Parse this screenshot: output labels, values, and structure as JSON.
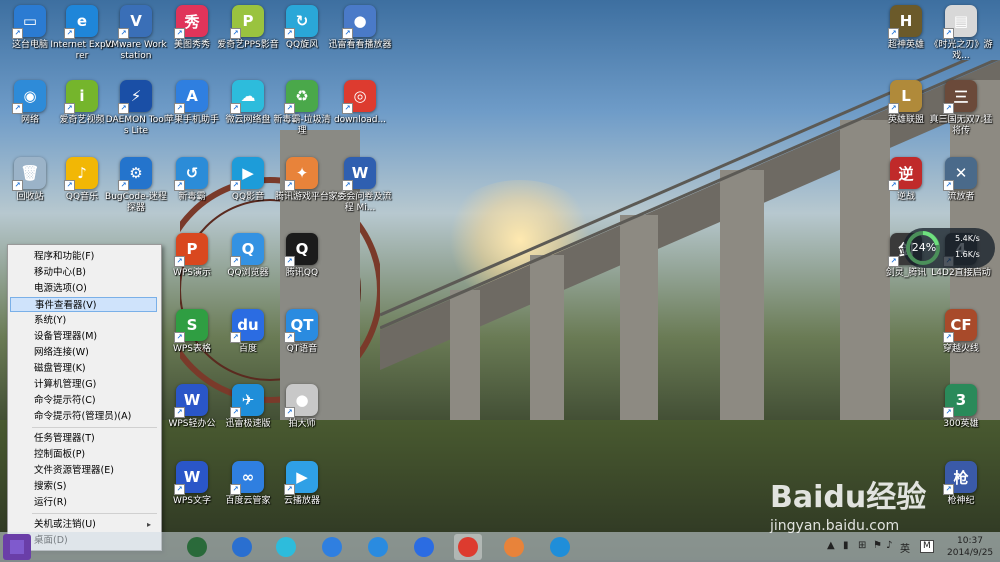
{
  "desktop_icons": [
    {
      "label": "这台电脑",
      "color": "#2b7bd2",
      "glyph": "▭"
    },
    {
      "label": "Internet Explorer",
      "color": "#1f86d9",
      "glyph": "e"
    },
    {
      "label": "VMware Workstation",
      "color": "#3a6fb7",
      "glyph": "V"
    },
    {
      "label": "美图秀秀",
      "color": "#e0345a",
      "glyph": "秀"
    },
    {
      "label": "爱奇艺PPS影音",
      "color": "#9ac33f",
      "glyph": "P"
    },
    {
      "label": "QQ旋风",
      "color": "#2aa7d8",
      "glyph": "↻"
    },
    {
      "label": "迅雷看看播放器",
      "color": "#4a7ac8",
      "glyph": "●"
    },
    {
      "label": "网络",
      "color": "#2e8bd8",
      "glyph": "◉"
    },
    {
      "label": "爱奇艺视频",
      "color": "#75b52c",
      "glyph": "i"
    },
    {
      "label": "DAEMON Tools Lite",
      "color": "#1a4fa6",
      "glyph": "⚡"
    },
    {
      "label": "苹果手机助手",
      "color": "#2f7fe0",
      "glyph": "A"
    },
    {
      "label": "微云网络盘",
      "color": "#2dbcdc",
      "glyph": "☁"
    },
    {
      "label": "新毒霸-垃圾清理",
      "color": "#4aa84a",
      "glyph": "♻"
    },
    {
      "label": "download...",
      "color": "#dd3b2f",
      "glyph": "◎"
    },
    {
      "label": "回收站",
      "color": "#9bb3c8",
      "glyph": "🗑"
    },
    {
      "label": "QQ音乐",
      "color": "#f2b705",
      "glyph": "♪"
    },
    {
      "label": "BugCode-迷程探器",
      "color": "#2474cc",
      "glyph": "⚙"
    },
    {
      "label": "新毒霸",
      "color": "#2b8cd8",
      "glyph": "↺"
    },
    {
      "label": "QQ影音",
      "color": "#1d9cd9",
      "glyph": "▶"
    },
    {
      "label": "腾讯游戏平台",
      "color": "#e8833a",
      "glyph": "✦"
    },
    {
      "label": "家委会问卷及流程 Mi...",
      "color": "#2f5fb0",
      "glyph": "W"
    },
    {
      "label": "WPS演示",
      "color": "#d9481f",
      "glyph": "P"
    },
    {
      "label": "QQ浏览器",
      "color": "#3492e2",
      "glyph": "Q"
    },
    {
      "label": "腾讯QQ",
      "color": "#1b1b1b",
      "glyph": "Q"
    },
    {
      "label": "WPS表格",
      "color": "#2f9e42",
      "glyph": "S"
    },
    {
      "label": "百度",
      "color": "#2b6ce2",
      "glyph": "du"
    },
    {
      "label": "QT语音",
      "color": "#2a8be0",
      "glyph": "QT"
    },
    {
      "label": "WPS轻办公",
      "color": "#2a56c8",
      "glyph": "W"
    },
    {
      "label": "迅雷极速版",
      "color": "#1f8ed9",
      "glyph": "✈"
    },
    {
      "label": "拍大师",
      "color": "#c8c8c8",
      "glyph": "●"
    },
    {
      "label": "WPS文字",
      "color": "#2a56c8",
      "glyph": "W"
    },
    {
      "label": "百度云管家",
      "color": "#2f7fe0",
      "glyph": "∞"
    },
    {
      "label": "云播放器",
      "color": "#2fa0e6",
      "glyph": "▶"
    },
    {
      "label": "超神英雄",
      "color": "#6b5a2a",
      "glyph": "H"
    },
    {
      "label": "《时光之刃》游戏...",
      "color": "#d8d8d8",
      "glyph": "▤"
    },
    {
      "label": "英雄联盟",
      "color": "#b08a3a",
      "glyph": "L"
    },
    {
      "label": "真三国无双7:猛将传",
      "color": "#6b4a3a",
      "glyph": "三"
    },
    {
      "label": "逆战",
      "color": "#c02a2a",
      "glyph": "逆"
    },
    {
      "label": "流放者",
      "color": "#4a6a8a",
      "glyph": "✕"
    },
    {
      "label": "剑灵_腾讯",
      "color": "#3a3a3a",
      "glyph": "剑"
    },
    {
      "label": "L4D2直接启动",
      "color": "#3a3a3a",
      "glyph": "4"
    },
    {
      "label": "穿越火线",
      "color": "#a84a2a",
      "glyph": "CF"
    },
    {
      "label": "300英雄",
      "color": "#2a8a5a",
      "glyph": "3"
    },
    {
      "label": "枪神纪",
      "color": "#3a5aa8",
      "glyph": "枪"
    }
  ],
  "context_menu": {
    "items": [
      {
        "label": "程序和功能(F)"
      },
      {
        "label": "移动中心(B)"
      },
      {
        "label": "电源选项(O)"
      },
      {
        "label": "事件查看器(V)",
        "selected": true
      },
      {
        "label": "系统(Y)"
      },
      {
        "label": "设备管理器(M)"
      },
      {
        "label": "网络连接(W)"
      },
      {
        "label": "磁盘管理(K)"
      },
      {
        "label": "计算机管理(G)"
      },
      {
        "label": "命令提示符(C)"
      },
      {
        "label": "命令提示符(管理员)(A)"
      },
      {
        "label": "任务管理器(T)"
      },
      {
        "label": "控制面板(P)"
      },
      {
        "label": "文件资源管理器(E)"
      },
      {
        "label": "搜索(S)"
      },
      {
        "label": "运行(R)"
      },
      {
        "label": "关机或注销(U)",
        "submenu": "▸"
      },
      {
        "label": "桌面(D)"
      }
    ]
  },
  "gauge": {
    "percent": "24%",
    "upload": "5.4K/s",
    "download": "1.6K/s"
  },
  "taskbar": {
    "apps": [
      "shield",
      "globe",
      "cloud",
      "baidu-cloud",
      "qq-browser",
      "baidu",
      "chrome",
      "tencent-games",
      "xunlei"
    ],
    "tray_ime": "英",
    "tray_m": "M",
    "time": "10:37",
    "date": "2014/9/25"
  },
  "watermark": {
    "brand": "Baidu经验",
    "url": "jingyan.baidu.com"
  }
}
